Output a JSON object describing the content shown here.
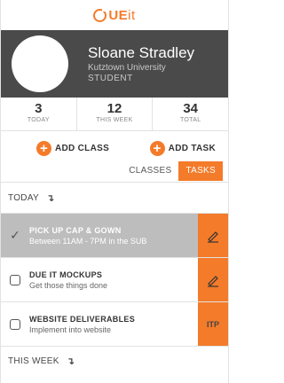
{
  "app": {
    "logo_main": "UE",
    "logo_tail": "it"
  },
  "profile": {
    "name": "Sloane Stradley",
    "school": "Kutztown University",
    "role": "STUDENT"
  },
  "stats": [
    {
      "value": "3",
      "label": "TODAY"
    },
    {
      "value": "12",
      "label": "THIS WEEK"
    },
    {
      "value": "34",
      "label": "TOTAL"
    }
  ],
  "actions": {
    "add_class": "ADD CLASS",
    "add_task": "ADD TASK"
  },
  "tabs": {
    "classes": "CLASSES",
    "tasks": "TASKS",
    "active": "tasks"
  },
  "sections": {
    "today": "TODAY",
    "this_week": "THIS WEEK"
  },
  "tasks": [
    {
      "title": "PICK UP CAP & GOWN",
      "subtitle": "Between 11AM - 7PM in the SUB",
      "done": true,
      "side": "edit"
    },
    {
      "title": "DUE IT MOCKUPS",
      "subtitle": "Get those things done",
      "done": false,
      "side": "edit"
    },
    {
      "title": "WEBSITE DELIVERABLES",
      "subtitle": "Implement into website",
      "done": false,
      "side_label": "ITP"
    }
  ],
  "colors": {
    "accent": "#f47b2a",
    "profile_bg": "#4a4a4a",
    "done_bg": "#bdbdbd"
  },
  "icons": {
    "edit": "pencil-icon",
    "check": "checkmark-icon",
    "section": "turn-down-arrow-icon",
    "add": "plus-icon"
  }
}
